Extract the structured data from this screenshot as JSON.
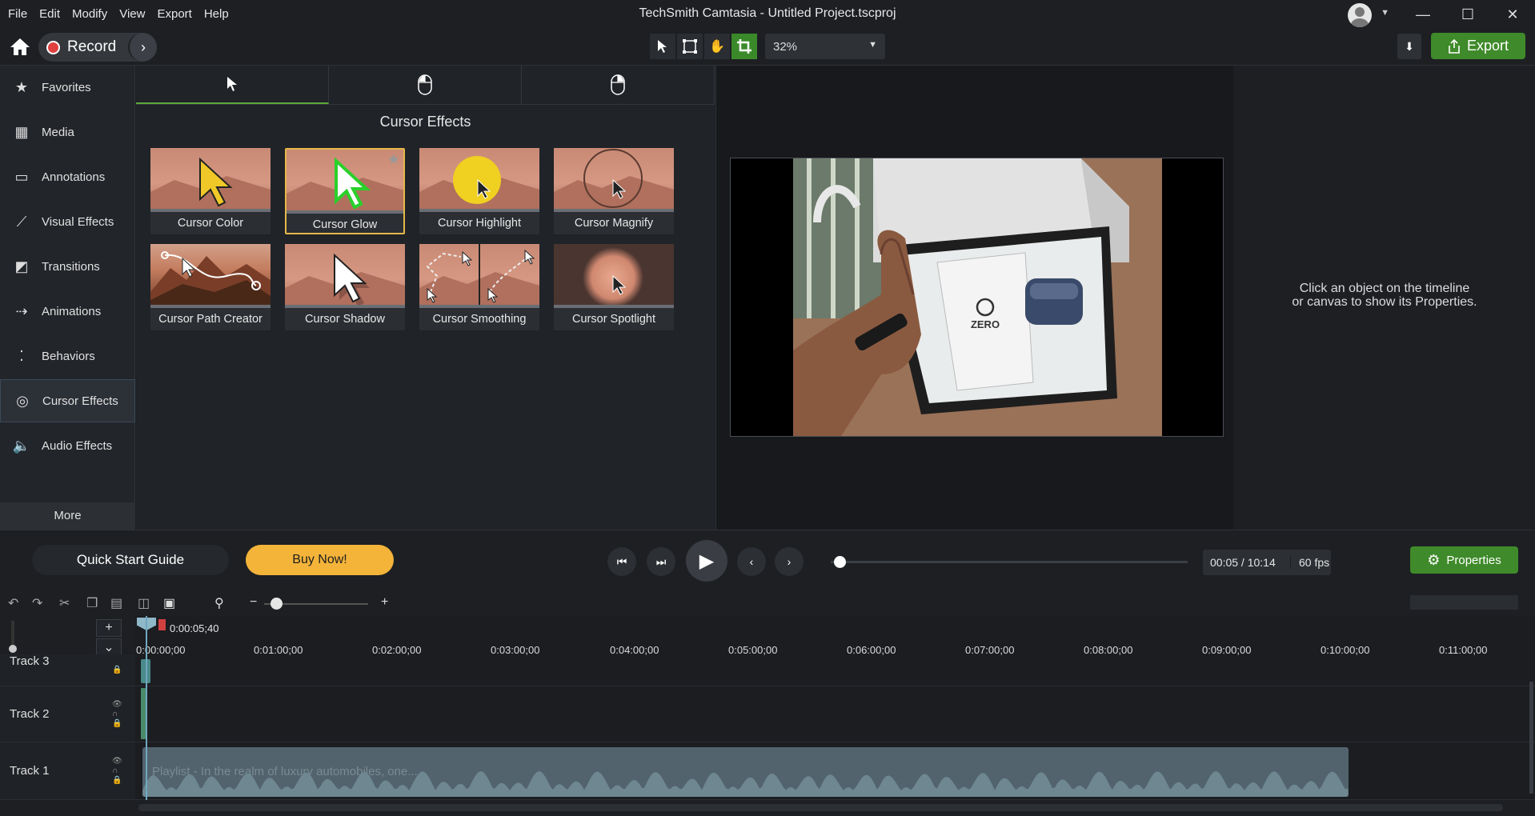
{
  "window": {
    "title": "TechSmith Camtasia - Untitled Project.tscproj"
  },
  "menu": [
    "File",
    "Edit",
    "Modify",
    "View",
    "Export",
    "Help"
  ],
  "toolbar": {
    "record_label": "Record",
    "zoom": "32%",
    "export_label": "Export"
  },
  "sidebar": {
    "items": [
      {
        "label": "Favorites",
        "icon": "star-icon"
      },
      {
        "label": "Media",
        "icon": "film-icon"
      },
      {
        "label": "Annotations",
        "icon": "annotation-icon"
      },
      {
        "label": "Visual Effects",
        "icon": "wand-icon"
      },
      {
        "label": "Transitions",
        "icon": "transition-icon"
      },
      {
        "label": "Animations",
        "icon": "animation-icon"
      },
      {
        "label": "Behaviors",
        "icon": "behavior-icon"
      },
      {
        "label": "Cursor Effects",
        "icon": "cursor-effects-icon",
        "active": true
      },
      {
        "label": "Audio Effects",
        "icon": "speaker-icon"
      }
    ],
    "more_label": "More"
  },
  "library": {
    "title": "Cursor Effects",
    "tabs": [
      "cursor-tab",
      "left-click-tab",
      "right-click-tab"
    ],
    "tiles": [
      {
        "label": "Cursor Color"
      },
      {
        "label": "Cursor Glow",
        "selected": true
      },
      {
        "label": "Cursor Highlight"
      },
      {
        "label": "Cursor Magnify"
      },
      {
        "label": "Cursor Path Creator"
      },
      {
        "label": "Cursor Shadow"
      },
      {
        "label": "Cursor Smoothing"
      },
      {
        "label": "Cursor Spotlight"
      }
    ]
  },
  "preview": {
    "box_brand": "ZERO"
  },
  "properties": {
    "hint_line1": "Click an object on the timeline",
    "hint_line2": "or canvas to show its Properties."
  },
  "transport": {
    "quick_start": "Quick Start Guide",
    "buy_now": "Buy Now!",
    "time": "00:05 / 10:14",
    "fps": "60 fps",
    "properties_label": "Properties",
    "progress_fraction": 0.008
  },
  "timeline": {
    "playhead_time": "0:00:05;40",
    "ticks": [
      "0:00:00;00",
      "0:01:00;00",
      "0:02:00;00",
      "0:03:00;00",
      "0:04:00;00",
      "0:05:00;00",
      "0:06:00;00",
      "0:07:00;00",
      "0:08:00;00",
      "0:09:00;00",
      "0:10:00;00",
      "0:11:00;00"
    ],
    "tracks": [
      {
        "name": "Track 3"
      },
      {
        "name": "Track 2"
      },
      {
        "name": "Track 1",
        "clip_label": "Playlist - In the realm of luxury automobiles, one..."
      }
    ]
  },
  "colors": {
    "accent_green": "#3f8a2a",
    "buy_yellow": "#f4b43a",
    "selected_tile": "#e6b84a",
    "record_red": "#e04040"
  }
}
